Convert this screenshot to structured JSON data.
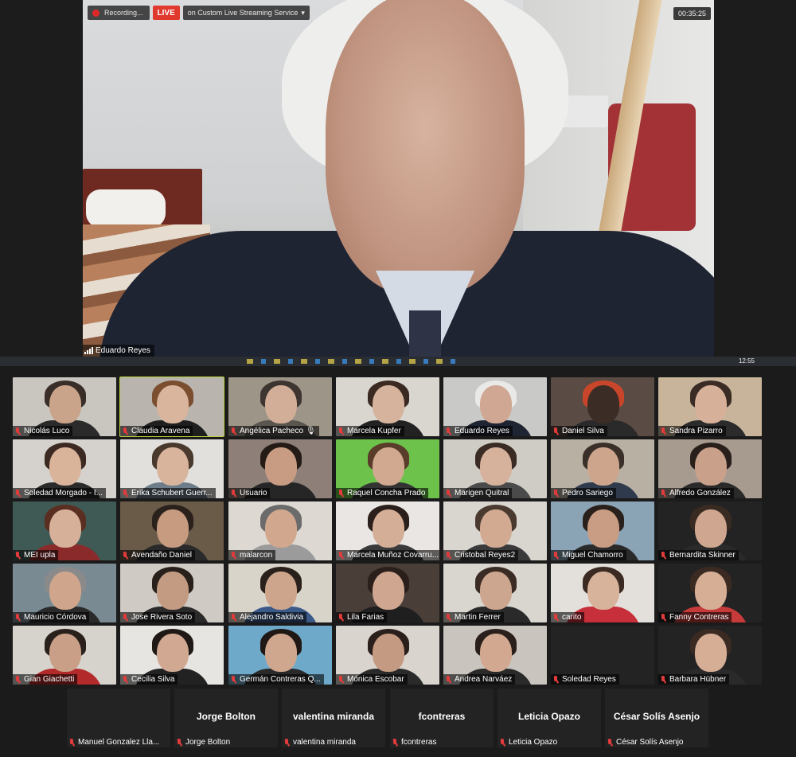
{
  "speaker": {
    "name": "Eduardo Reyes",
    "recording_label": "Recording...",
    "live_label": "LIVE",
    "stream_label": "on Custom Live Streaming Service",
    "timer": "00:35:25"
  },
  "taskbar": {
    "clock": "12:55"
  },
  "participants": [
    {
      "name": "Nicolás Luco",
      "bg": "#c9c6c0",
      "skin": "#c9a48a",
      "hair": "#3a2e28",
      "shirt": "#2a2a2a"
    },
    {
      "name": "Claudia Aravena",
      "bg": "#b9b4ad",
      "skin": "#d8b59c",
      "hair": "#7a4e2e",
      "shirt": "#1f1f1f",
      "active": true
    },
    {
      "name": "Angélica Pacheco 🎙",
      "bg": "#9d9587",
      "skin": "#d2ae98",
      "hair": "#3d3530",
      "shirt": "#5b5550"
    },
    {
      "name": "Marcela Kupfer",
      "bg": "#d9d6d0",
      "skin": "#d6b39c",
      "hair": "#3a2a22",
      "shirt": "#222"
    },
    {
      "name": "Eduardo Reyes",
      "bg": "#c9c9c7",
      "skin": "#cfa792",
      "hair": "#e9e9e7",
      "shirt": "#1f2433"
    },
    {
      "name": "Daniel Silva",
      "bg": "#5a4c44",
      "skin": "#3b2c25",
      "hair": "#c9462a",
      "shirt": "#2a2a2a"
    },
    {
      "name": "Sandra Pizarro",
      "bg": "#c7b49a",
      "skin": "#d6b099",
      "hair": "#3a2c25",
      "shirt": "#2b2b2b"
    },
    {
      "name": "Soledad Morgado - I...",
      "bg": "#d5d2cd",
      "skin": "#d9b49b",
      "hair": "#3c2a22",
      "shirt": "#2a2a2a"
    },
    {
      "name": "Erika Schubert Guerr...",
      "bg": "#e2e0dd",
      "skin": "#d8b49c",
      "hair": "#4a3a2e",
      "shirt": "#6e7d8a"
    },
    {
      "name": "Usuario",
      "bg": "#8e8078",
      "skin": "#c89c83",
      "hair": "#241a16",
      "shirt": "#262626"
    },
    {
      "name": "Raquel Concha Prado",
      "bg": "#6cc24a",
      "skin": "#d0a990",
      "hair": "#5a3c2a",
      "shirt": "#333"
    },
    {
      "name": "Marigen Quitral",
      "bg": "#cfcbc5",
      "skin": "#d6b19b",
      "hair": "#3a2b24",
      "shirt": "#4a4a4a"
    },
    {
      "name": "Pedro Sariego",
      "bg": "#b8b0a3",
      "skin": "#cda58d",
      "hair": "#3a3029",
      "shirt": "#2f3a4c"
    },
    {
      "name": "Alfredo González",
      "bg": "#a79a8e",
      "skin": "#c9a089",
      "hair": "#2a201b",
      "shirt": "#2a2a2a"
    },
    {
      "name": "MEI upla",
      "bg": "#3f5a54",
      "skin": "#d7b09a",
      "hair": "#5a2e20",
      "shirt": "#8a2a2a"
    },
    {
      "name": "Avendaño Daniel",
      "bg": "#6a5a48",
      "skin": "#c69b80",
      "hair": "#2a211c",
      "shirt": "#2a2a2a"
    },
    {
      "name": "malarcon",
      "bg": "#ddd9d2",
      "skin": "#d1a78e",
      "hair": "#6b6b6b",
      "shirt": "#9b9b9b"
    },
    {
      "name": "Marcela Muñoz Covarru...",
      "bg": "#e9e6e3",
      "skin": "#d4ae96",
      "hair": "#2a1f1a",
      "shirt": "#3a3a3a"
    },
    {
      "name": "Cristobal Reyes2",
      "bg": "#d9d5cf",
      "skin": "#d2aa92",
      "hair": "#4a3a30",
      "shirt": "#3a3a3a"
    },
    {
      "name": "Miguel Chamorro",
      "bg": "#8aa3b5",
      "skin": "#c89d84",
      "hair": "#2a201b",
      "shirt": "#2a2a2a"
    },
    {
      "name": "Bernardita Skinner",
      "bg": "#232323",
      "skin": "#cfa790",
      "hair": "#3a2b22",
      "shirt": "#2a2a2a"
    },
    {
      "name": "Mauricio Córdova",
      "bg": "#7a8a93",
      "skin": "#cfa58c",
      "hair": "#8a8a8a",
      "shirt": "#2a2a2a"
    },
    {
      "name": "Jose Rivera Soto",
      "bg": "#cfcac3",
      "skin": "#c39b82",
      "hair": "#2a201b",
      "shirt": "#2a2a2a"
    },
    {
      "name": "Alejandro Saldivia",
      "bg": "#d9d4c9",
      "skin": "#cda58c",
      "hair": "#2a201b",
      "shirt": "#3a5a8a"
    },
    {
      "name": "Lila Farias",
      "bg": "#4a3e38",
      "skin": "#cfa690",
      "hair": "#2a1f1a",
      "shirt": "#1f1f1f"
    },
    {
      "name": "Martin Ferrer",
      "bg": "#d9d6d0",
      "skin": "#cda690",
      "hair": "#3a2c24",
      "shirt": "#2a2a2a"
    },
    {
      "name": "carito",
      "bg": "#e3dfda",
      "skin": "#d8b39b",
      "hair": "#3a2a22",
      "shirt": "#c72f3a"
    },
    {
      "name": "Fanny Contreras",
      "bg": "#232323",
      "skin": "#d6ad95",
      "hair": "#3a2a22",
      "shirt": "#c73a3a"
    },
    {
      "name": "Gian Giachetti",
      "bg": "#d6d2cc",
      "skin": "#c99f87",
      "hair": "#2a201b",
      "shirt": "#b32a2a"
    },
    {
      "name": "Cecilia Silva",
      "bg": "#e7e5e2",
      "skin": "#d1a993",
      "hair": "#1f1814",
      "shirt": "#222"
    },
    {
      "name": "Germán Contreras Q...",
      "bg": "#6fa9c9",
      "skin": "#cfa78e",
      "hair": "#1f1814",
      "shirt": "#2a2a2a"
    },
    {
      "name": "Mónica Escobar",
      "bg": "#d9d4ce",
      "skin": "#c49b82",
      "hair": "#2a1f1a",
      "shirt": "#2a2a2a"
    },
    {
      "name": "Andrea Narváez",
      "bg": "#c9c4bd",
      "skin": "#d2a890",
      "hair": "#2a1f1a",
      "shirt": "#2a2a2a"
    },
    {
      "name": "Soledad Reyes",
      "bg": "#232323",
      "skin": "#232323",
      "hair": "#232323",
      "shirt": "#232323",
      "empty": true
    },
    {
      "name": "Barbara Hübner",
      "bg": "#232323",
      "skin": "#d6ae96",
      "hair": "#3a2a22",
      "shirt": "#2a2a2a"
    }
  ],
  "name_only": [
    {
      "big": "",
      "label": "Manuel Gonzalez Lla..."
    },
    {
      "big": "Jorge Bolton",
      "label": "Jorge Bolton"
    },
    {
      "big": "valentina miranda",
      "label": "valentina miranda"
    },
    {
      "big": "fcontreras",
      "label": "fcontreras"
    },
    {
      "big": "Leticia Opazo",
      "label": "Leticia Opazo"
    },
    {
      "big": "César Solís Asenjo",
      "label": "César Solís Asenjo"
    }
  ]
}
